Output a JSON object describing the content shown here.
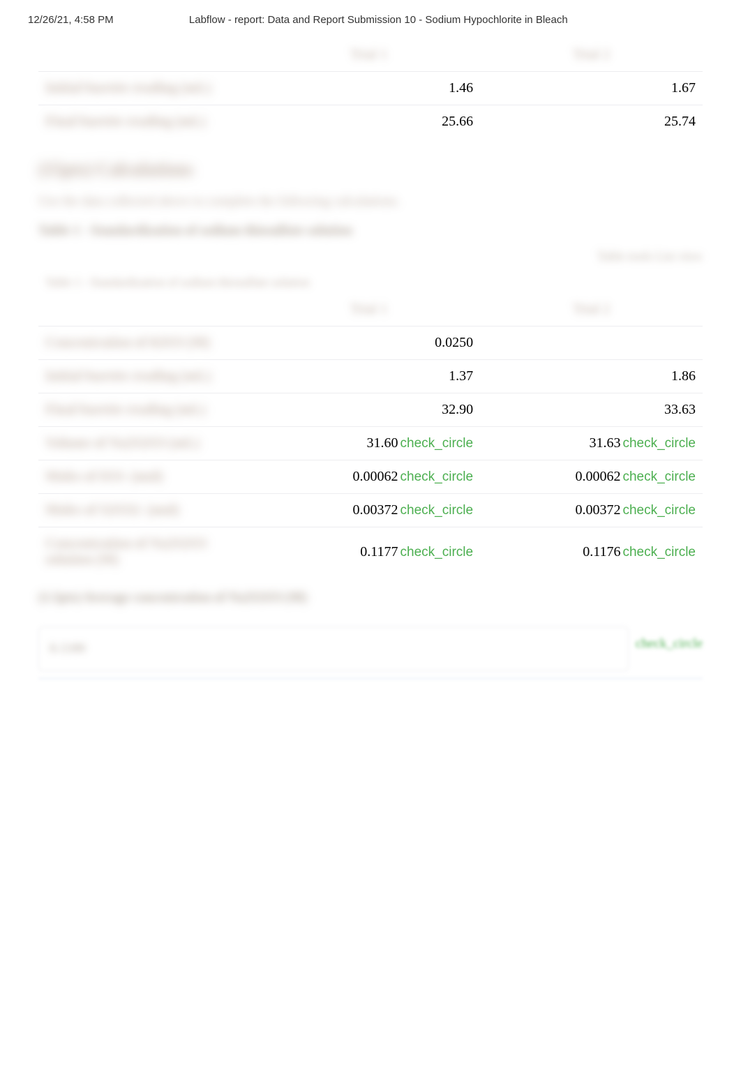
{
  "header": {
    "date": "12/26/21, 4:58 PM",
    "title": "Labflow - report: Data and Report Submission 10 - Sodium Hypochlorite in Bleach"
  },
  "table1": {
    "col1": "Trial 1",
    "col2": "Trial 2",
    "rows": [
      {
        "label": "Initial burette reading (mL)",
        "v1": "1.46",
        "v2": "1.67"
      },
      {
        "label": "Final burette reading (mL)",
        "v1": "25.66",
        "v2": "25.74"
      }
    ]
  },
  "section": {
    "heading": "(15pts) Calculations",
    "instruction": "Use the data collected above to complete the following calculations.",
    "subheading": "Table 1 - Standardization of sodium thiosulfate solution"
  },
  "tableTools": "Table tools      List view",
  "table2": {
    "caption": "Table 1 - Standardization of sodium thiosulfate solution",
    "col1": "Trial 1",
    "col2": "Trial 2",
    "rows": [
      {
        "label": "Concentration of KIO3 (M)",
        "v1": "0.0250",
        "v2": "",
        "check": false
      },
      {
        "label": "Initial burette reading (mL)",
        "v1": "1.37",
        "v2": "1.86",
        "check": false
      },
      {
        "label": "Final burette reading (mL)",
        "v1": "32.90",
        "v2": "33.63",
        "check": false
      },
      {
        "label": "Volume of Na2S2O3 (mL)",
        "v1": "31.60",
        "v2": "31.63",
        "check": true
      },
      {
        "label": "Moles of IO3- (mol)",
        "v1": "0.00062",
        "v2": "0.00062",
        "check": true
      },
      {
        "label": "Moles of S2O32- (mol)",
        "v1": "0.00372",
        "v2": "0.00372",
        "check": true
      },
      {
        "label": "Concentration of Na2S2O3 solution (M)",
        "v1": "0.1177",
        "v2": "0.1176",
        "check": true
      }
    ]
  },
  "q1": {
    "label": "(1.5pts) Average concentration of Na2S2O3 (M)",
    "value": "0.1180"
  },
  "check_text": "check_circle"
}
